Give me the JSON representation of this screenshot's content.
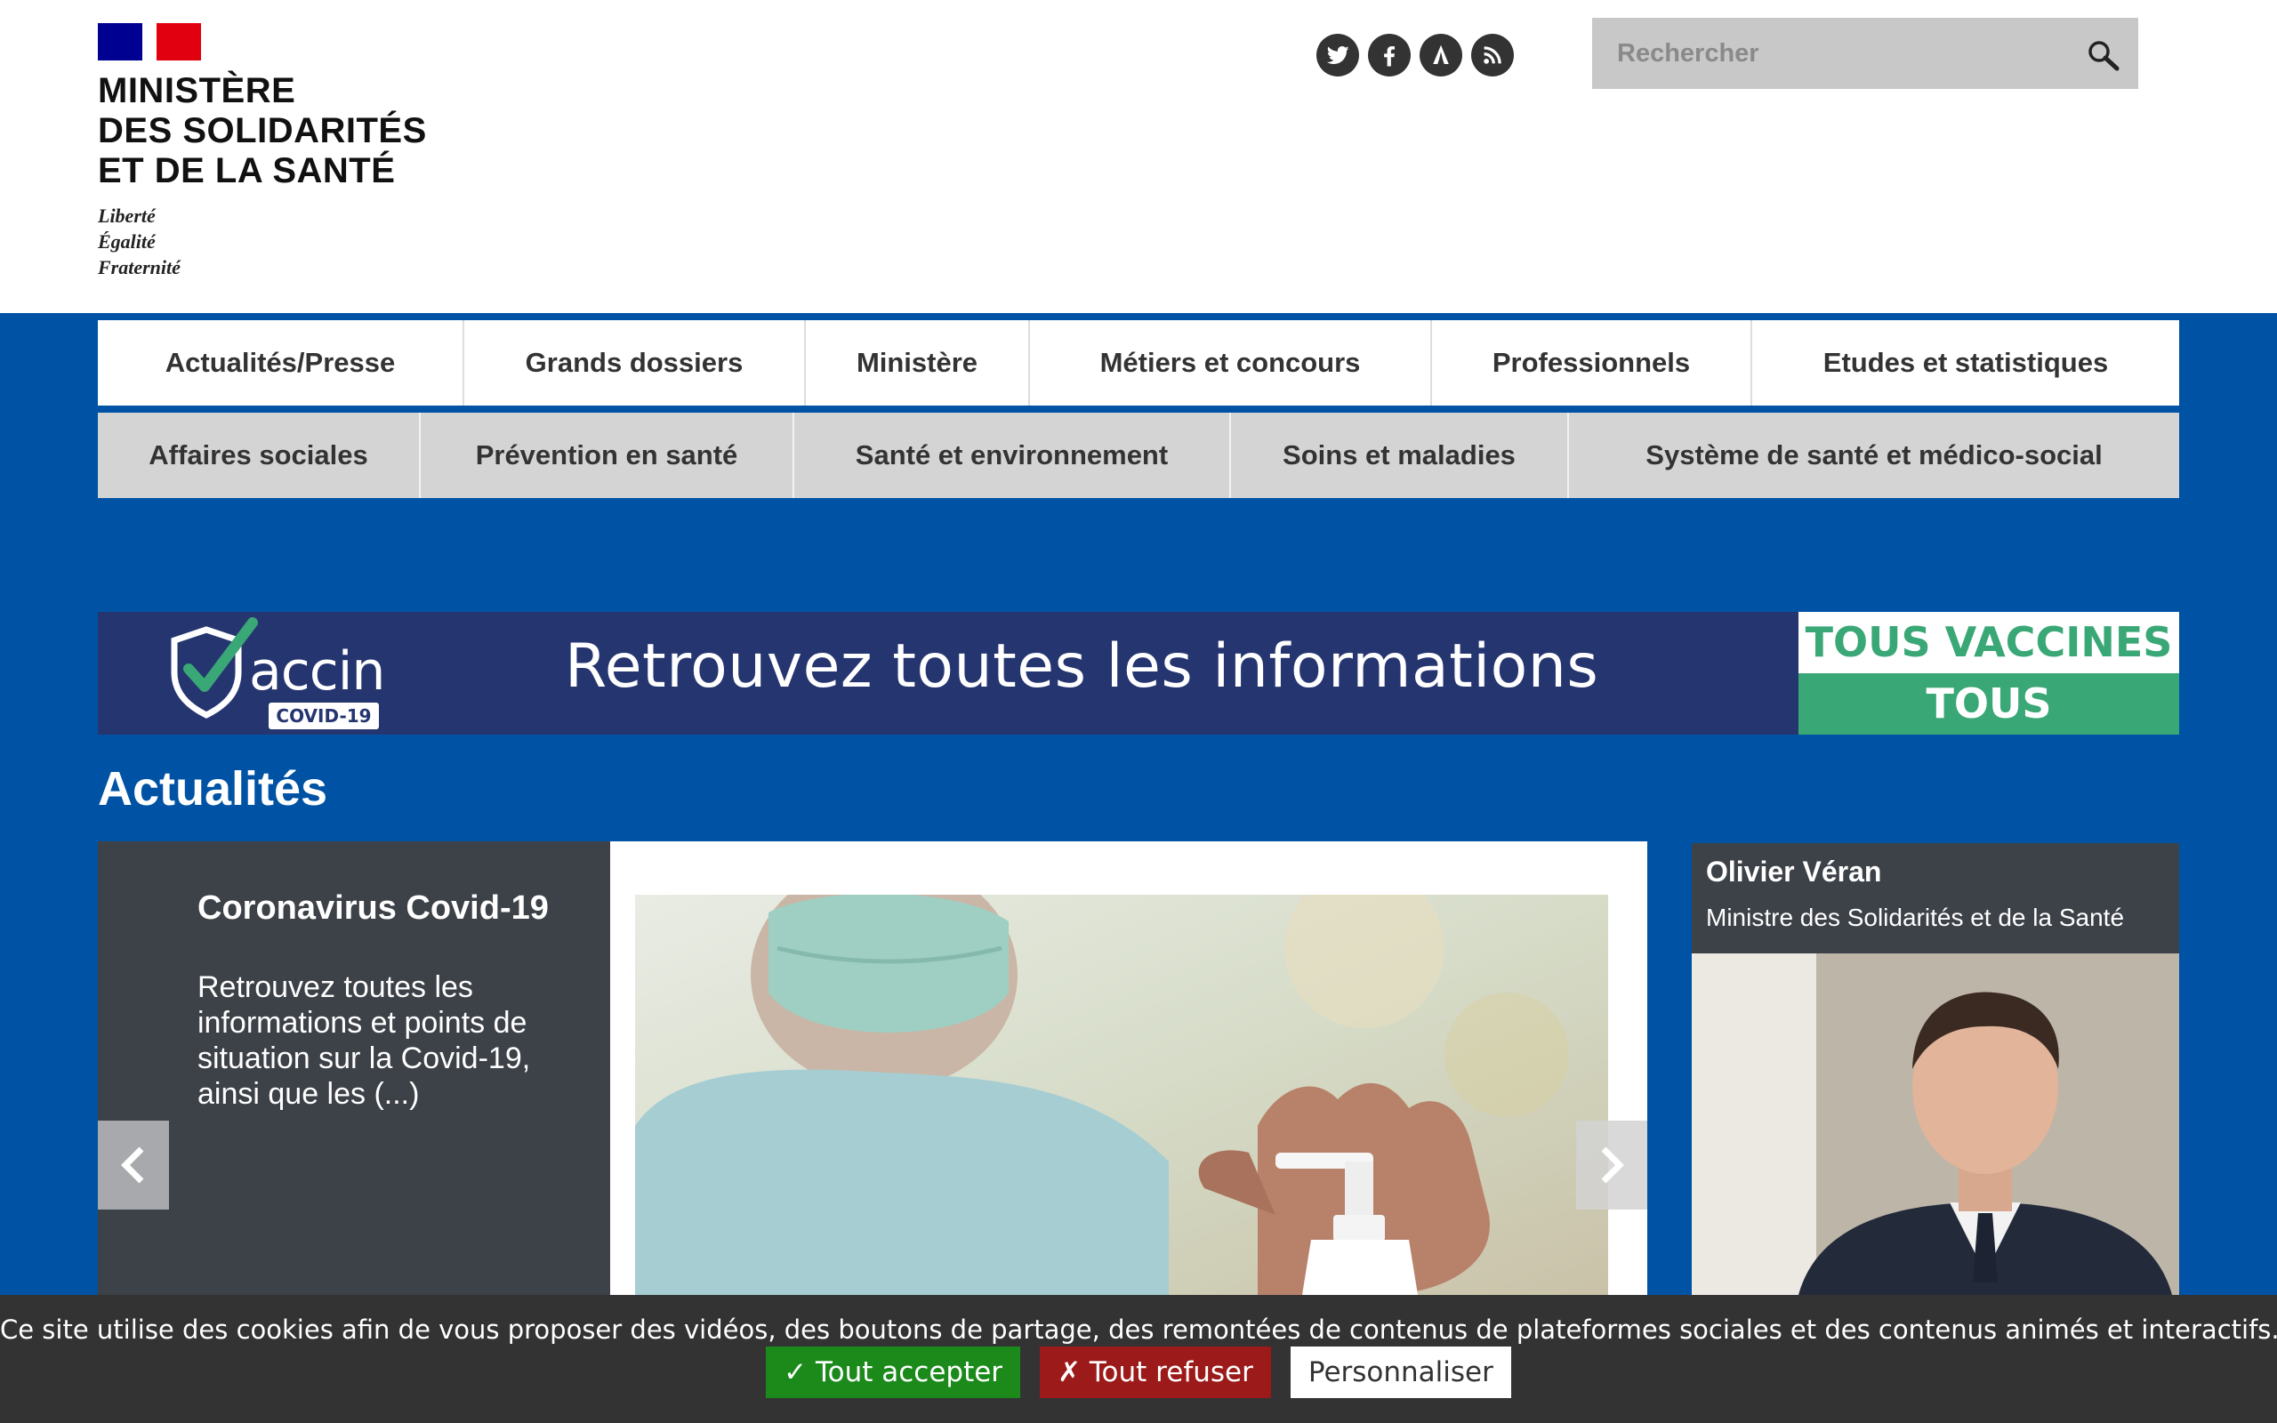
{
  "header": {
    "ministry_lines": [
      "MINISTÈRE",
      "DES SOLIDARITÉS",
      "ET DE LA SANTÉ"
    ],
    "motto_lines": [
      "Liberté",
      "Égalité",
      "Fraternité"
    ],
    "social_icons": [
      "twitter-icon",
      "facebook-icon",
      "dailymotion-icon",
      "rss-icon"
    ],
    "search": {
      "placeholder": "Rechercher",
      "value": ""
    }
  },
  "nav": {
    "primary": [
      "Actualités/Presse",
      "Grands dossiers",
      "Ministère",
      "Métiers et concours",
      "Professionnels",
      "Etudes et statistiques"
    ],
    "secondary": [
      "Affaires sociales",
      "Prévention en santé",
      "Santé et environnement",
      "Soins et maladies",
      "Système de santé et médico-social"
    ]
  },
  "banner": {
    "logo_word": "accin",
    "logo_tag": "COVID-19",
    "text": "Retrouvez toutes les informations",
    "slogan_top": "TOUS VACCINES",
    "slogan_bottom": "TOUS PROTEGES"
  },
  "news": {
    "section_title": "Actualités",
    "title": "Coronavirus Covid-19",
    "summary": "Retrouvez toutes les informations et points de situation sur la Covid-19, ainsi que les (...)"
  },
  "minister": {
    "name": "Olivier Véran",
    "role": "Ministre des Solidarités et de la Santé"
  },
  "cookie": {
    "message": "Ce site utilise des cookies afin de vous proposer des vidéos, des boutons de partage, des remontées de contenus de plateformes sociales et des contenus animés et interactifs.",
    "accept": "✓ Tout accepter",
    "refuse": "✗ Tout refuser",
    "customize": "Personnaliser"
  },
  "colors": {
    "page_blue": "#0053a4",
    "banner_navy": "#253570",
    "slogan_green": "#3aa776",
    "accept_green": "#1b8a1b",
    "refuse_red": "#9c1a1a"
  }
}
